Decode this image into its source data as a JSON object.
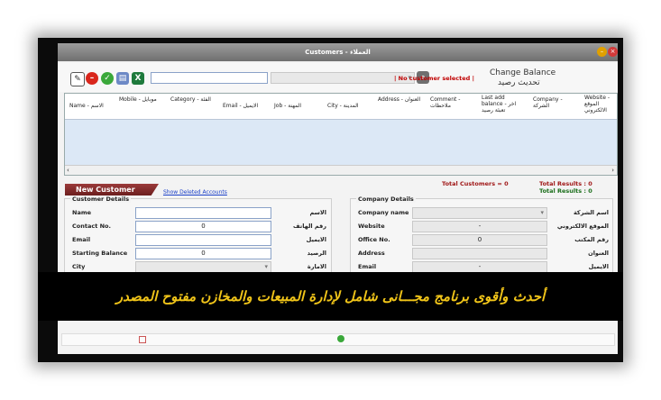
{
  "window": {
    "title": "Customers - العملاء"
  },
  "toolbar": {
    "search_value": "",
    "no_customer_label": "| No customer selected |",
    "change_balance_en": "Change Balance",
    "change_balance_ar": "تحديث رصيد"
  },
  "grid": {
    "columns": [
      "Name - الاسم",
      "Mobile - موبايل",
      "Category - الفئة",
      "Email - الايميل",
      "Job - المهنة",
      "City - المدينة",
      "Address - العنوان",
      "Comment - ملاحظات",
      "Last add balance - اخر تعبئة رصيد",
      "Company - الشركة",
      "Website - الموقع الالكتروني"
    ]
  },
  "summary": {
    "new_customer": "New Customer",
    "show_deleted": "Show Deleted Accounts",
    "total_customers": "Total Customers = 0",
    "total_results_red": "Total Results : 0",
    "total_results_green": "Total Results : 0"
  },
  "customer_details": {
    "title": "Customer Details",
    "rows": [
      {
        "label": "Name",
        "label_ar": "الاسم",
        "value": ""
      },
      {
        "label": "Contact No.",
        "label_ar": "رقم الهاتف",
        "value": "0"
      },
      {
        "label": "Email",
        "label_ar": "الايميل",
        "value": ""
      },
      {
        "label": "Starting Balance",
        "label_ar": "الرصيد",
        "value": "0"
      },
      {
        "label": "City",
        "label_ar": "الامارة",
        "value": ""
      }
    ]
  },
  "company_details": {
    "title": "Company Details",
    "rows": [
      {
        "label": "Company name",
        "label_ar": "اسم الشركة",
        "value": ""
      },
      {
        "label": "Website",
        "label_ar": "الموقع الالكتروني",
        "value": "-"
      },
      {
        "label": "Office No.",
        "label_ar": "رقم المكتب",
        "value": "0"
      },
      {
        "label": "Address",
        "label_ar": "العنوان",
        "value": ""
      },
      {
        "label": "Email",
        "label_ar": "الايميل",
        "value": "-"
      }
    ]
  },
  "overlay": {
    "caption": "أحدث وأقوى برنامج مجـــانى شامل لإدارة المبيعات والمخازن مفتوح المصدر"
  },
  "colors": {
    "accent_red": "#c00000",
    "banner": "#8a2c2c",
    "overlay_text": "#f0c419"
  }
}
